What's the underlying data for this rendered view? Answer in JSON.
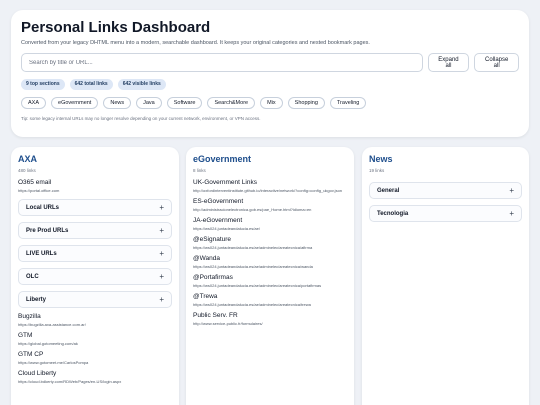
{
  "header": {
    "title": "Personal Links Dashboard",
    "subtitle": "Converted from your legacy DHTML menu into a modern, searchable dashboard. It keeps your original categories and nested bookmark pages.",
    "search_placeholder": "Search by title or URL...",
    "expand_all": "Expand all",
    "collapse_all": "Collapse all",
    "stats": [
      "9 top sections",
      "642 total links",
      "642 visible links"
    ],
    "chips": [
      "AXA",
      "eGovernment",
      "News",
      "Java",
      "Software",
      "Search&More",
      "Mix",
      "Shopping",
      "Traveling"
    ],
    "tip": "Tip: some legacy internal URLs may no longer resolve depending on your current network, environment, or VPN access."
  },
  "panels": {
    "axa": {
      "title": "AXA",
      "count": "480 links",
      "top_link": {
        "name": "O365 email",
        "url": "https://portal.office.com"
      },
      "groups": [
        "Local URLs",
        "Pre Prod URLs",
        "LIVE URLs",
        "OLC",
        "Liberty"
      ],
      "links": [
        {
          "name": "Bugzilla",
          "url": "https://bugzilla.axa-assistance.com.ar/"
        },
        {
          "name": "GTM",
          "url": "https://global.gotomeeting.com/ak"
        },
        {
          "name": "GTM CP",
          "url": "https://www.gotomeet.me/CarlosPompa"
        },
        {
          "name": "Cloud Liberty",
          "url": "https://cloud.bdkerty.com/RDWeb/Pages/en-US/login.aspx"
        }
      ]
    },
    "egov": {
      "title": "eGovernment",
      "count": "8 links",
      "links": [
        {
          "name": "UK-Government Links",
          "url": "http://oxfordinterventinstitute.github.io/interactive/network/?config=config_ukgov.json"
        },
        {
          "name": "ES-eGovernment",
          "url": "http://administracionelectronica.gob.es/pae_Home.html?idioma=en"
        },
        {
          "name": "JA-eGovernment",
          "url": "https://ws024.juntadeandalucia.es/ae/"
        },
        {
          "name": "@eSignature",
          "url": "https://ws024.juntadeandalucia.es/ae/adminelec/areatecnica/afirma"
        },
        {
          "name": "@Wanda",
          "url": "https://ws024.juntadeandalucia.es/ae/adminelec/areatecnica/wanda"
        },
        {
          "name": "@Portafirmas",
          "url": "https://ws024.juntadeandalucia.es/ae/adminelec/areatecnica/portafirmas"
        },
        {
          "name": "@Trewa",
          "url": "https://ws024.juntadeandalucia.es/ae/adminelec/areatecnica/trewa"
        },
        {
          "name": "Public Serv. FR",
          "url": "http://www.service-public.fr/formulaires/"
        }
      ]
    },
    "news": {
      "title": "News",
      "count": "19 links",
      "groups": [
        "General",
        "Tecnologia"
      ]
    }
  },
  "icons": {
    "expand": "plus-icon"
  },
  "colors": {
    "accent": "#1e4e8c",
    "background": "#eef1f6",
    "stat_bg": "#dde7f6"
  }
}
